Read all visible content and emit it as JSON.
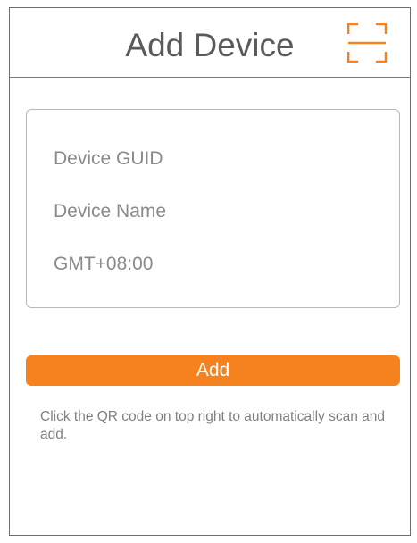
{
  "header": {
    "title": "Add Device",
    "scan_icon": "qr-scan-icon"
  },
  "form": {
    "guid_placeholder": "Device GUID",
    "name_placeholder": "Device Name",
    "timezone_value": "GMT+08:00"
  },
  "add_button_label": "Add",
  "hint_text": "Click the QR code on top right to automatically scan and add.",
  "colors": {
    "accent": "#f5821f",
    "title": "#5a5a5a",
    "placeholder": "#8a8a8a",
    "hint": "#7f7f7f"
  }
}
